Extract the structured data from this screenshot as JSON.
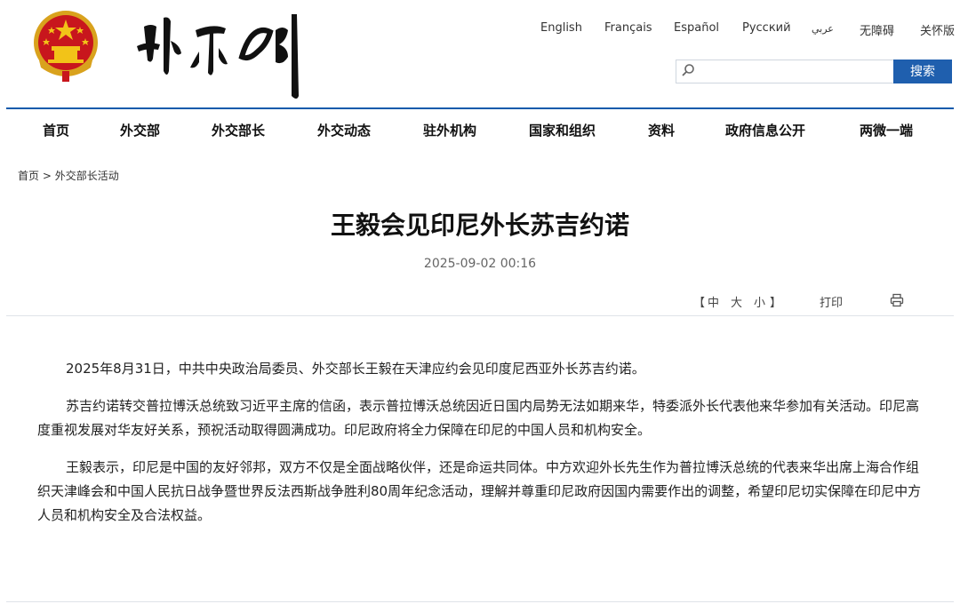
{
  "header": {
    "languages": [
      "English",
      "Français",
      "Español",
      "Русский",
      "عربي",
      "无障碍",
      "关怀版"
    ],
    "search": {
      "placeholder": "",
      "button_label": "搜索"
    }
  },
  "nav": [
    "首页",
    "外交部",
    "外交部长",
    "外交动态",
    "驻外机构",
    "国家和组织",
    "资料",
    "政府信息公开",
    "两微一端"
  ],
  "breadcrumb": {
    "home": "首页",
    "separator": ">",
    "section": "外交部长活动"
  },
  "article": {
    "title": "王毅会见印尼外长苏吉约诺",
    "date": "2025-09-02 00:16",
    "font_controls": {
      "open": "【",
      "medium": "中",
      "large": "大",
      "small": "小",
      "close": "】"
    },
    "print_label": "打印",
    "paragraphs": [
      "2025年8月31日，中共中央政治局委员、外交部长王毅在天津应约会见印度尼西亚外长苏吉约诺。",
      "苏吉约诺转交普拉博沃总统致习近平主席的信函，表示普拉博沃总统因近日国内局势无法如期来华，特委派外长代表他来华参加有关活动。印尼高度重视发展对华友好关系，预祝活动取得圆满成功。印尼政府将全力保障在印尼的中国人员和机构安全。",
      "王毅表示，印尼是中国的友好邻邦，双方不仅是全面战略伙伴，还是命运共同体。中方欢迎外长先生作为普拉博沃总统的代表来华出席上海合作组织天津峰会和中国人民抗日战争暨世界反法西斯战争胜利80周年纪念活动，理解并尊重印尼政府因国内需要作出的调整，希望印尼切实保障在印尼中方人员和机构安全及合法权益。"
    ]
  },
  "colors": {
    "accent_blue": "#1f5fae",
    "emblem_red": "#c8161d",
    "emblem_gold": "#f2c318"
  }
}
